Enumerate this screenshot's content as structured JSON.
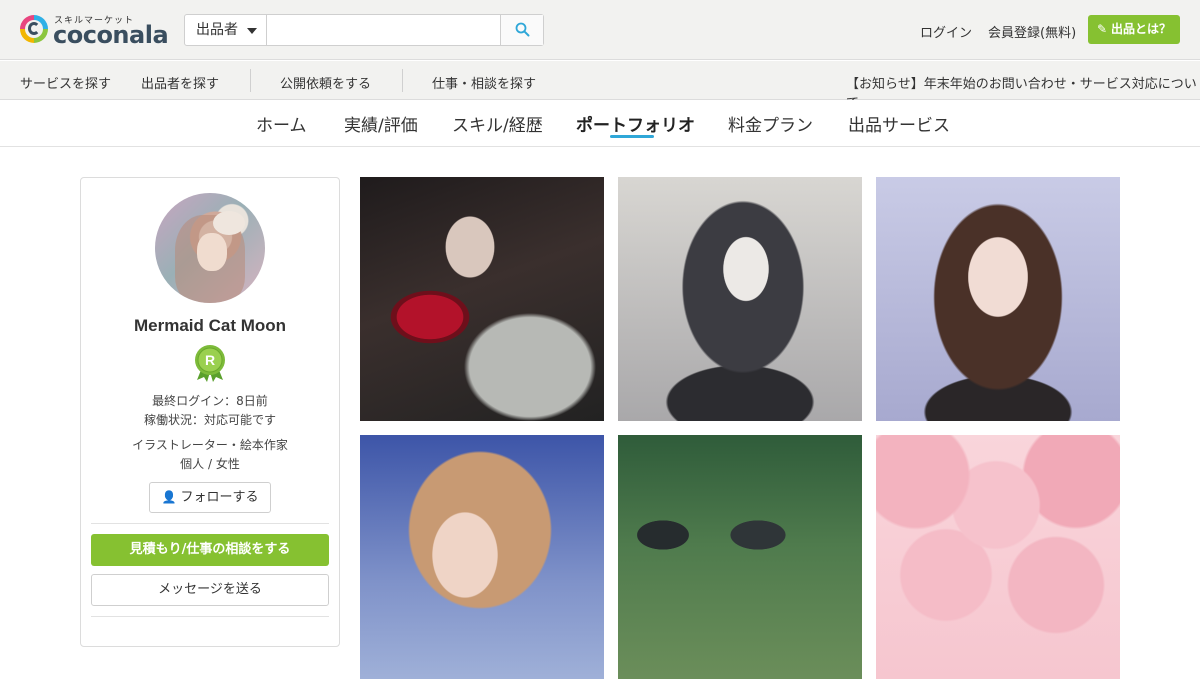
{
  "header": {
    "logo_sub": "スキルマーケット",
    "logo_text": "coconala",
    "search": {
      "category": "出品者",
      "placeholder": ""
    },
    "login": "ログイン",
    "register": "会員登録(無料)",
    "about_button": "出品とは？"
  },
  "subnav": {
    "items": [
      "サービスを探す",
      "出品者を探す",
      "公開依頼をする",
      "仕事・相談を探す"
    ],
    "notice": "【お知らせ】年末年始のお問い合わせ・サービス対応について"
  },
  "tabs": {
    "items": [
      "ホーム",
      "実績/評価",
      "スキル/経歴",
      "ポートフォリオ",
      "料金プラン",
      "出品サービス"
    ],
    "active_index": 3,
    "accent_color": "#2fa7d8"
  },
  "profile": {
    "name": "Mermaid Cat Moon",
    "rank_badge": "R",
    "last_login": "最終ログイン：8日前",
    "availability": "稼働状況：対応可能です",
    "occupation": "イラストレーター・絵本作家",
    "type": "個人 / 女性",
    "follow_button": "フォローする",
    "consult_button": "見積もり/仕事の相談をする",
    "message_button": "メッセージを送る"
  },
  "colors": {
    "brand_green": "#86c131",
    "header_bg": "#f2f2f0"
  },
  "portfolio": {
    "items": [
      {
        "icon": "portfolio-image"
      },
      {
        "icon": "portfolio-image"
      },
      {
        "icon": "portfolio-image"
      },
      {
        "icon": "portfolio-image"
      },
      {
        "icon": "portfolio-image"
      },
      {
        "icon": "portfolio-image"
      }
    ]
  }
}
